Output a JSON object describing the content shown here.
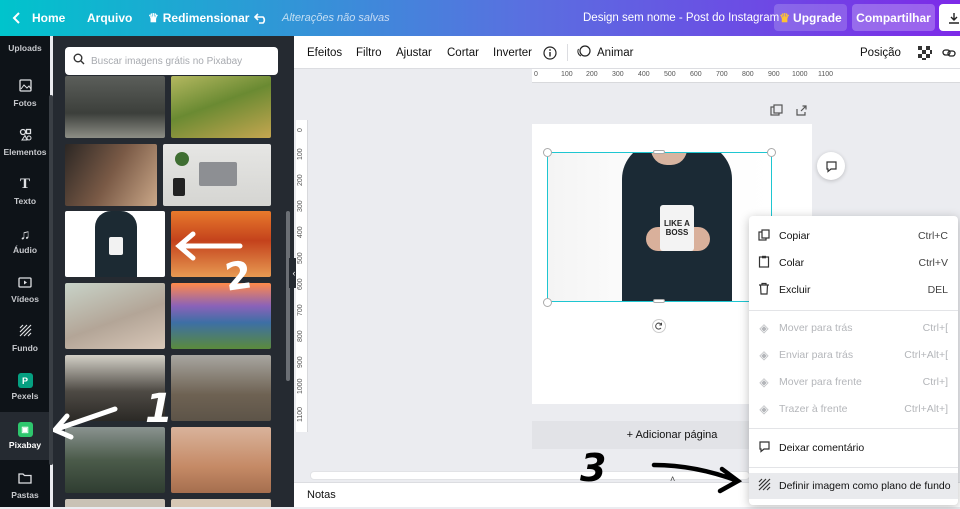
{
  "topbar": {
    "home": "Home",
    "file": "Arquivo",
    "resize": "Redimensionar",
    "unsaved": "Alterações não salvas",
    "design_title": "Design sem nome - Post do Instagram",
    "upgrade": "Upgrade",
    "share": "Compartilhar"
  },
  "rail": {
    "items": [
      {
        "label": "Uploads",
        "icon": "upload-icon"
      },
      {
        "label": "Fotos",
        "icon": "image-icon"
      },
      {
        "label": "Elementos",
        "icon": "shapes-icon"
      },
      {
        "label": "Texto",
        "icon": "text-icon"
      },
      {
        "label": "Áudio",
        "icon": "music-note-icon"
      },
      {
        "label": "Vídeos",
        "icon": "video-icon"
      },
      {
        "label": "Fundo",
        "icon": "pattern-icon"
      },
      {
        "label": "Pexels",
        "icon": "pexels-icon"
      },
      {
        "label": "Pixabay",
        "icon": "pixabay-icon"
      },
      {
        "label": "Pastas",
        "icon": "folder-icon"
      }
    ],
    "active": "Pixabay"
  },
  "panel": {
    "search_placeholder": "Buscar imagens grátis no Pixabay"
  },
  "toolbar": {
    "effects": "Efeitos",
    "filter": "Filtro",
    "adjust": "Ajustar",
    "crop": "Cortar",
    "flip": "Inverter",
    "animate": "Animar",
    "position": "Posição"
  },
  "ruler": {
    "top": [
      "0",
      "100",
      "200",
      "300",
      "400",
      "500",
      "600",
      "700",
      "800",
      "900",
      "1000",
      "1100"
    ],
    "left": [
      "0",
      "100",
      "200",
      "300",
      "400",
      "500",
      "600",
      "700",
      "800",
      "900",
      "1000",
      "1100"
    ]
  },
  "canvas": {
    "add_page": "+ Adicionar página",
    "notes": "Notas",
    "mug_text": "LIKE A BOSS"
  },
  "context_menu": {
    "items": [
      {
        "icon": "copy-icon",
        "label": "Copiar",
        "shortcut": "Ctrl+C"
      },
      {
        "icon": "paste-icon",
        "label": "Colar",
        "shortcut": "Ctrl+V"
      },
      {
        "icon": "trash-icon",
        "label": "Excluir",
        "shortcut": "DEL"
      },
      {
        "icon": "send-backward-icon",
        "label": "Mover para trás",
        "shortcut": "Ctrl+["
      },
      {
        "icon": "send-to-back-icon",
        "label": "Enviar para trás",
        "shortcut": "Ctrl+Alt+["
      },
      {
        "icon": "bring-forward-icon",
        "label": "Mover para frente",
        "shortcut": "Ctrl+]"
      },
      {
        "icon": "bring-to-front-icon",
        "label": "Trazer à frente",
        "shortcut": "Ctrl+Alt+]"
      },
      {
        "icon": "comment-icon",
        "label": "Deixar comentário",
        "shortcut": ""
      },
      {
        "icon": "background-icon",
        "label": "Definir imagem como plano de fundo",
        "shortcut": ""
      }
    ]
  },
  "annotations": {
    "one": "1",
    "two": "2",
    "three": "3"
  },
  "colors": {
    "gradient_start": "#00c4cc",
    "gradient_end": "#7d2ae8",
    "selection": "#1ec6d1",
    "pixabay_green": "#2ec66d",
    "pexels_green": "#05a081"
  }
}
